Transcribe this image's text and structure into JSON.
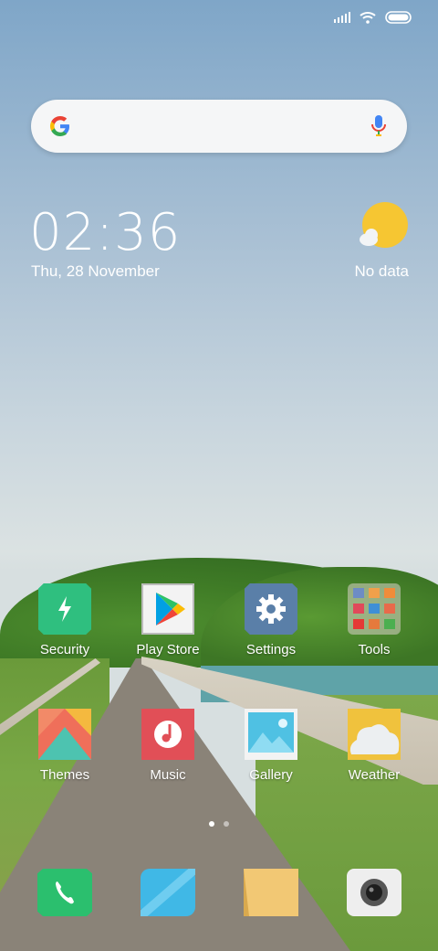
{
  "status_bar": {
    "signal_icon": "signal-bars-icon",
    "wifi_icon": "wifi-icon",
    "battery_icon": "battery-icon"
  },
  "search_bar": {
    "logo_icon": "google-logo-icon",
    "mic_icon": "microphone-icon"
  },
  "clock_widget": {
    "time": "02:36",
    "date": "Thu, 28 November"
  },
  "weather_widget": {
    "icon": "partly-sunny-icon",
    "text": "No data"
  },
  "apps": [
    {
      "label": "Security",
      "icon": "security-shield-icon",
      "color": "#2fbf7f"
    },
    {
      "label": "Play Store",
      "icon": "play-store-icon",
      "color": "#f3f3f3"
    },
    {
      "label": "Settings",
      "icon": "gear-icon",
      "color": "#5a7fa8"
    },
    {
      "label": "Tools",
      "icon": "folder-grid-icon",
      "color": "#d9d2c9"
    },
    {
      "label": "Themes",
      "icon": "themes-icon",
      "color": "#ef6f5a"
    },
    {
      "label": "Music",
      "icon": "music-note-icon",
      "color": "#e14f57"
    },
    {
      "label": "Gallery",
      "icon": "gallery-mountain-icon",
      "color": "#4fc1e3"
    },
    {
      "label": "Weather",
      "icon": "weather-cloud-icon",
      "color": "#f0c23d"
    }
  ],
  "page_indicator": {
    "pages": 2,
    "current": 1
  },
  "dock": [
    {
      "icon": "phone-icon",
      "color": "#2bbf6e"
    },
    {
      "icon": "messages-icon",
      "color": "#40b8e6"
    },
    {
      "icon": "notes-icon",
      "color": "#f0c46b"
    },
    {
      "icon": "camera-icon",
      "color": "#eeeeee"
    }
  ]
}
